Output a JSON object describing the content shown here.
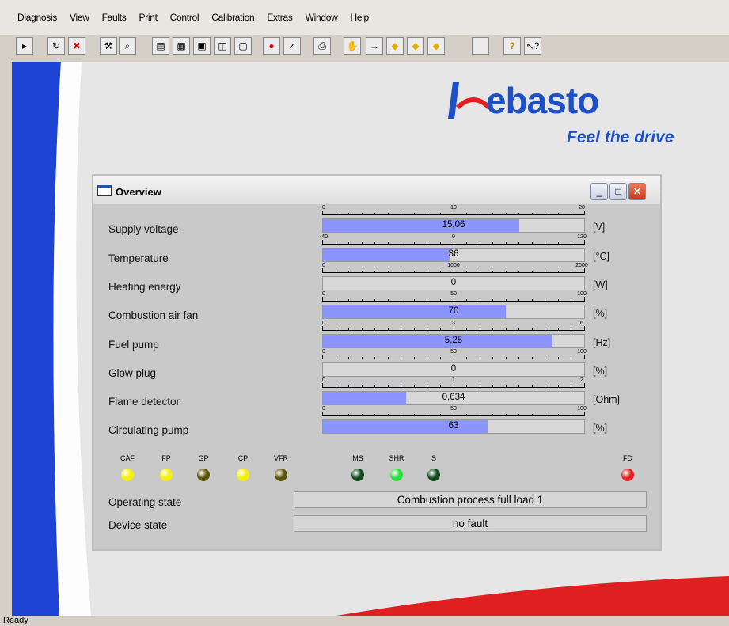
{
  "menu": [
    "Diagnosis",
    "View",
    "Faults",
    "Print",
    "Control",
    "Calibration",
    "Extras",
    "Window",
    "Help"
  ],
  "toolbar_icons": [
    "open-icon",
    "refresh-icon",
    "stop-icon",
    "tool-icon",
    "zoom-icon",
    "chart-icon",
    "grid-icon",
    "panel-icon",
    "graph-icon",
    "window-icon",
    "record-icon",
    "check-icon",
    "print-icon",
    "hand-icon",
    "arrow-icon",
    "diamond-icon",
    "diamond-icon",
    "diamond-icon",
    "blank-icon",
    "help-icon",
    "context-help-icon"
  ],
  "branding": {
    "logo_word": "ebasto",
    "tagline": "Feel the drive",
    "brand_blue": "#1d4fc5",
    "accent_red": "#e02020"
  },
  "window": {
    "title": "Overview",
    "rows": [
      {
        "label": "Supply voltage",
        "value": "15,06",
        "unit": "[V]",
        "fraction": 0.753,
        "ticks": [
          "0",
          "10",
          "20"
        ]
      },
      {
        "label": "Temperature",
        "value": "36",
        "unit": "[°C]",
        "fraction": 0.485,
        "ticks": [
          "-40",
          "0",
          "120"
        ]
      },
      {
        "label": "Heating energy",
        "value": "0",
        "unit": "[W]",
        "fraction": 0.0,
        "ticks": [
          "0",
          "1000",
          "2000"
        ]
      },
      {
        "label": "Combustion air fan",
        "value": "70",
        "unit": "[%]",
        "fraction": 0.7,
        "ticks": [
          "0",
          "50",
          "100"
        ]
      },
      {
        "label": "Fuel pump",
        "value": "5,25",
        "unit": "[Hz]",
        "fraction": 0.875,
        "ticks": [
          "0",
          "3",
          "6"
        ]
      },
      {
        "label": "Glow plug",
        "value": "0",
        "unit": "[%]",
        "fraction": 0.0,
        "ticks": [
          "0",
          "50",
          "100"
        ]
      },
      {
        "label": "Flame detector",
        "value": "0,634",
        "unit": "[Ohm]",
        "fraction": 0.317,
        "ticks": [
          "0",
          "1",
          "2"
        ]
      },
      {
        "label": "Circulating pump",
        "value": "63",
        "unit": "[%]",
        "fraction": 0.63,
        "ticks": [
          "0",
          "50",
          "100"
        ]
      }
    ],
    "leds": [
      {
        "label": "CAF",
        "color": "#f5f000"
      },
      {
        "label": "FP",
        "color": "#f5f000"
      },
      {
        "label": "GP",
        "color": "#5a5200"
      },
      {
        "label": "CP",
        "color": "#f5f000"
      },
      {
        "label": "VFR",
        "color": "#5a5200"
      },
      {
        "label": "MS",
        "color": "#0f4a1a"
      },
      {
        "label": "SHR",
        "color": "#28e03a"
      },
      {
        "label": "S",
        "color": "#0f4a1a"
      },
      {
        "label": "FD",
        "color": "#e61e1e"
      }
    ],
    "operating_state_label": "Operating state",
    "operating_state_value": "Combustion process full load 1",
    "device_state_label": "Device state",
    "device_state_value": "no fault"
  },
  "status": {
    "text": "Ready"
  }
}
